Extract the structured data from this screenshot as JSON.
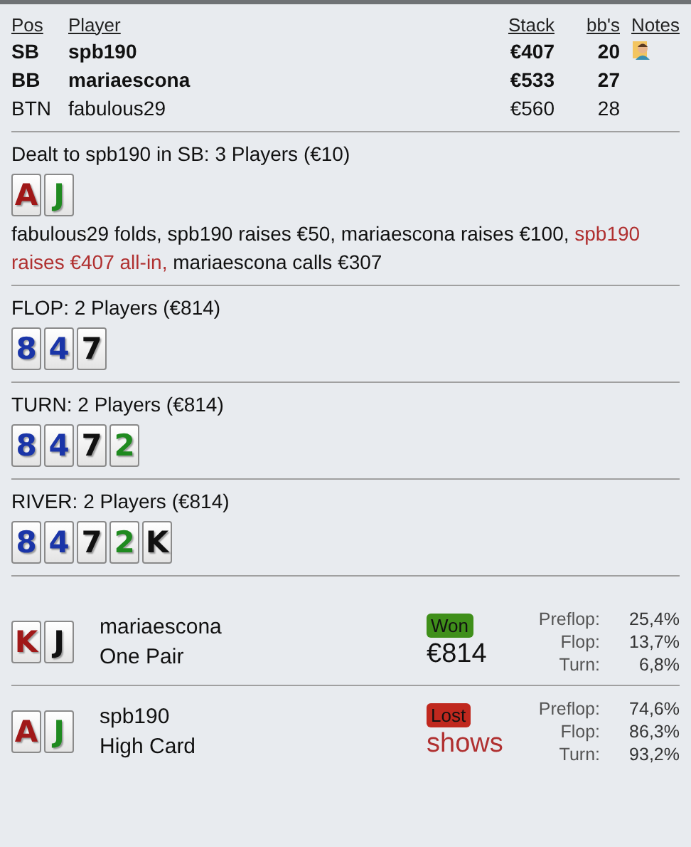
{
  "players": {
    "columns": [
      "Pos",
      "Player",
      "Stack",
      "bb's",
      "Notes"
    ],
    "rows": [
      {
        "pos": "SB",
        "name": "spb190",
        "stack": "€407",
        "bbs": "20",
        "active": true,
        "has_note": true
      },
      {
        "pos": "BB",
        "name": "mariaescona",
        "stack": "€533",
        "bbs": "27",
        "active": true,
        "has_note": false
      },
      {
        "pos": "BTN",
        "name": "fabulous29",
        "stack": "€560",
        "bbs": "28",
        "active": false,
        "has_note": false
      }
    ]
  },
  "streets": [
    {
      "title": "Dealt to spb190 in SB: 3 Players (€10)",
      "cards": [
        {
          "rank": "A",
          "color": "#a01818"
        },
        {
          "rank": "J",
          "color": "#1f8a1f"
        }
      ],
      "actions": [
        {
          "text": "fabulous29 folds, spb190 raises €50, mariaescona raises €100, ",
          "highlight": false
        },
        {
          "text": "spb190 raises €407 all-in,",
          "highlight": true
        },
        {
          "text": " mariaescona calls €307",
          "highlight": false
        }
      ]
    },
    {
      "title": "FLOP: 2 Players (€814)",
      "cards": [
        {
          "rank": "8",
          "color": "#1a35a8"
        },
        {
          "rank": "4",
          "color": "#1a35a8"
        },
        {
          "rank": "7",
          "color": "#111111"
        }
      ]
    },
    {
      "title": "TURN: 2 Players (€814)",
      "cards": [
        {
          "rank": "8",
          "color": "#1a35a8"
        },
        {
          "rank": "4",
          "color": "#1a35a8"
        },
        {
          "rank": "7",
          "color": "#111111"
        },
        {
          "rank": "2",
          "color": "#1f8a1f"
        }
      ]
    },
    {
      "title": "RIVER: 2 Players (€814)",
      "cards": [
        {
          "rank": "8",
          "color": "#1a35a8"
        },
        {
          "rank": "4",
          "color": "#1a35a8"
        },
        {
          "rank": "7",
          "color": "#111111"
        },
        {
          "rank": "2",
          "color": "#1f8a1f"
        },
        {
          "rank": "K",
          "color": "#111111"
        }
      ]
    }
  ],
  "results": [
    {
      "cards": [
        {
          "rank": "K",
          "color": "#a01818"
        },
        {
          "rank": "J",
          "color": "#111111"
        }
      ],
      "name": "mariaescona",
      "hand": "One Pair",
      "kind": "won",
      "badge": "Won",
      "amount": "€814",
      "equity": [
        {
          "label": "Preflop:",
          "value": "25,4%"
        },
        {
          "label": "Flop:",
          "value": "13,7%"
        },
        {
          "label": "Turn:",
          "value": "6,8%"
        }
      ]
    },
    {
      "cards": [
        {
          "rank": "A",
          "color": "#a01818"
        },
        {
          "rank": "J",
          "color": "#1f8a1f"
        }
      ],
      "name": "spb190",
      "hand": "High Card",
      "kind": "lost",
      "badge": "Lost",
      "amount": "shows",
      "equity": [
        {
          "label": "Preflop:",
          "value": "74,6%"
        },
        {
          "label": "Flop:",
          "value": "86,3%"
        },
        {
          "label": "Turn:",
          "value": "93,2%"
        }
      ]
    }
  ]
}
